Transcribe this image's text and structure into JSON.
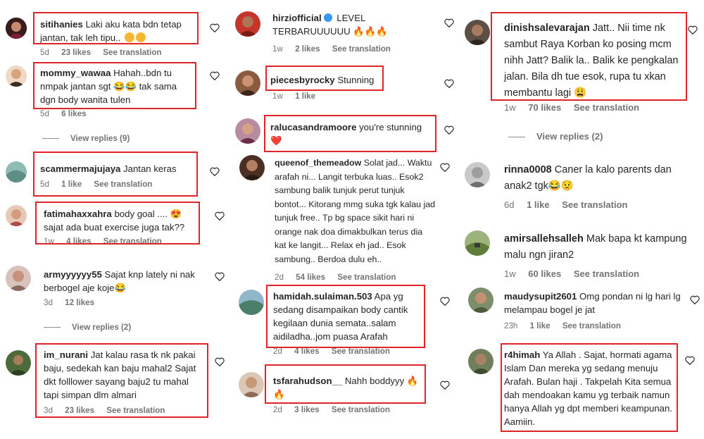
{
  "col1": [
    {
      "user": "sitihanies",
      "text": "Laki aku kata bdn tetap jantan, tak leh tipu..",
      "emoji": "😁😁",
      "age": "5d",
      "likes": "23 likes",
      "translate": "See translation"
    },
    {
      "user": "mommy_wawaa",
      "text": "Hahah..bdn tu nmpak jantan sgt 😂😂 tak sama dgn body wanita tulen",
      "age": "5d",
      "likes": "6 likes",
      "view_replies": "View replies (9)"
    },
    {
      "user": "scammermajujaya",
      "text": "Jantan keras",
      "age": "5d",
      "likes": "1 like",
      "translate": "See translation"
    },
    {
      "user": "fatimahaxxahra",
      "text": "body goal .... 😍 sajat ada buat exercise juga tak??",
      "age": "1w",
      "likes": "4 likes",
      "translate": "See translation"
    },
    {
      "user": "armyyyyyy55",
      "text": "Sajat knp lately ni nak berbogel aje koje😂",
      "age": "3d",
      "likes": "12 likes",
      "view_replies": "View replies (2)"
    },
    {
      "user": "im_nurani",
      "text": "Jat kalau rasa tk nk pakai baju, sedekah kan baju mahal2 Sajat dkt folllower sayang baju2 tu mahal tapi simpan dlm almari",
      "age": "3d",
      "likes": "23 likes",
      "translate": "See translation"
    }
  ],
  "col2": [
    {
      "user": "hirziofficial",
      "text": "LEVEL TERBARUUUUUU 🔥🔥🔥",
      "age": "1w",
      "likes": "2 likes",
      "translate": "See translation"
    },
    {
      "user": "piecesbyrocky",
      "text": "Stunning",
      "age": "1w",
      "likes": "1 like"
    },
    {
      "user": "ralucasandramoore",
      "text": "you're stunning ❤️"
    },
    {
      "user": "queenof_themeadow",
      "text": "Solat jad... Waktu arafah ni... Langit terbuka luas.. Esok2 sambung balik tunjuk perut tunjuk bontot... Kitorang mmg suka tgk kalau jad tunjuk free.. Tp bg space sikit hari ni orange nak doa dimakbulkan terus dia kat ke langit... Relax eh jad.. Esok sambung.. Berdoa dulu eh..",
      "age": "2d",
      "likes": "54 likes",
      "translate": "See translation"
    },
    {
      "user": "hamidah.sulaiman.503",
      "text": "Apa yg sedang disampaikan body cantik kegilaan dunia semata..salam aidiladha..jom puasa Arafah",
      "age": "2d",
      "likes": "4 likes",
      "translate": "See translation"
    },
    {
      "user": "tsfarahudson__",
      "text": "Nahh boddyyy 🔥🔥",
      "age": "2d",
      "likes": "3 likes",
      "translate": "See translation"
    }
  ],
  "col3": [
    {
      "user": "dinishsalevarajan",
      "text": "Jatt.. Nii time nk sambut Raya Korban ko posing mcm nihh Jatt? Balik la.. Balik ke pengkalan jalan. Bila dh tue esok, rupa tu xkan membantu lagi 😩",
      "age": "1w",
      "likes": "70 likes",
      "translate": "See translation",
      "view_replies": "View replies (2)"
    },
    {
      "user": "rinna0008",
      "text": "Caner la kalo parents dan anak2 tgk😂😟",
      "age": "6d",
      "likes": "1 like",
      "translate": "See translation"
    },
    {
      "user": "amirsallehsalleh",
      "text": "Mak bapa kt kampung malu ngn jiran2",
      "age": "1w",
      "likes": "60 likes",
      "translate": "See translation"
    },
    {
      "user": "maudysupit2601",
      "text": "Omg pondan ni lg hari lg melampau bogel je jat",
      "age": "23h",
      "likes": "1 like",
      "translate": "See translation"
    },
    {
      "user": "r4himah",
      "text": "Ya Allah . Sajat, hormati agama Islam Dan mereka yg sedang menuju Arafah. Bulan haji . Takpelah Kita semua dah mendoakan kamu yg terbaik namun hanya Allah yg dpt memberi keampunan. Aamiin."
    }
  ],
  "colors": {
    "highlight": "#e0242a",
    "meta": "#737373",
    "text": "#262626"
  }
}
